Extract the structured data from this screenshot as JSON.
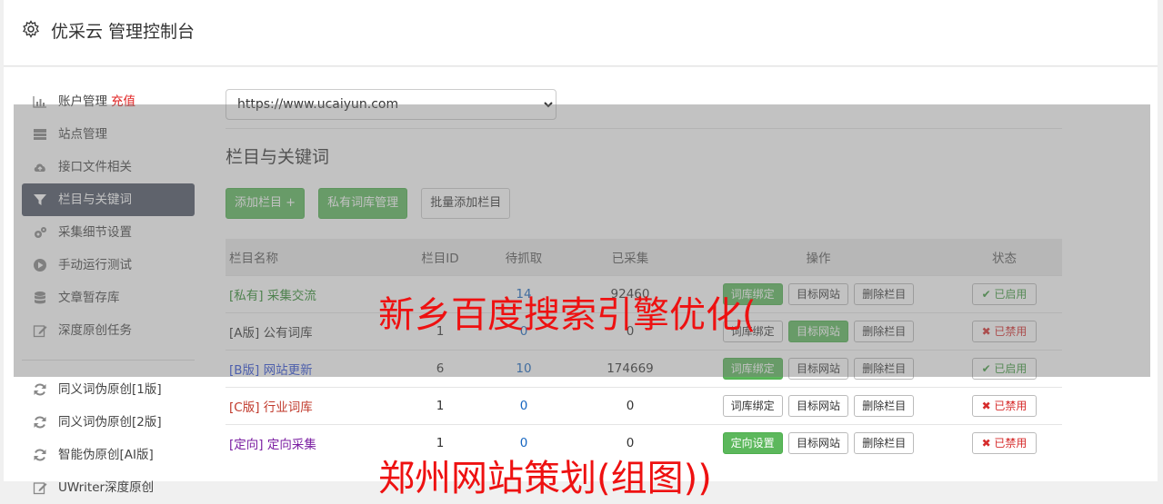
{
  "header": {
    "title": "优采云 管理控制台"
  },
  "sidebar": {
    "account_label": "账户管理",
    "recharge": "充值",
    "items": [
      {
        "label": "站点管理",
        "icon": "server-icon"
      },
      {
        "label": "接口文件相关",
        "icon": "cloud-upload-icon"
      },
      {
        "label": "栏目与关键词",
        "icon": "filter-icon"
      },
      {
        "label": "采集细节设置",
        "icon": "gears-icon"
      },
      {
        "label": "手动运行测试",
        "icon": "play-icon"
      },
      {
        "label": "文章暂存库",
        "icon": "database-icon"
      },
      {
        "label": "深度原创任务",
        "icon": "edit-icon"
      }
    ],
    "tools": [
      {
        "label": "同义词伪原创[1版]",
        "icon": "refresh-icon"
      },
      {
        "label": "同义词伪原创[2版]",
        "icon": "refresh-icon"
      },
      {
        "label": "智能伪原创[AI版]",
        "icon": "refresh-icon"
      },
      {
        "label": "UWriter深度原创",
        "icon": "edit-icon"
      }
    ]
  },
  "site_select": {
    "value": "https://www.ucaiyun.com"
  },
  "section": {
    "title": "栏目与关键词"
  },
  "buttons": {
    "add_column": "添加栏目 +",
    "private_lib": "私有词库管理",
    "batch_add": "批量添加栏目"
  },
  "table": {
    "headers": [
      "栏目名称",
      "栏目ID",
      "待抓取",
      "已采集",
      "操作",
      "状态"
    ],
    "rows": [
      {
        "tag": "[私有]",
        "name": "采集交流",
        "id": "",
        "pending": "14",
        "collected": "92460",
        "op1": "词库绑定",
        "op2": "目标网站",
        "op3": "删除栏目",
        "status": "✔ 已启用"
      },
      {
        "tag": "[A版]",
        "name": "公有词库",
        "id": "1",
        "pending": "0",
        "collected": "0",
        "op1": "词库绑定",
        "op2": "目标网站",
        "op3": "删除栏目",
        "status": "✖ 已禁用"
      },
      {
        "tag": "[B版]",
        "name": "网站更新",
        "id": "6",
        "pending": "10",
        "collected": "174669",
        "op1": "词库绑定",
        "op2": "目标网站",
        "op3": "删除栏目",
        "status": "✔ 已启用"
      },
      {
        "tag": "[C版]",
        "name": "行业词库",
        "id": "1",
        "pending": "0",
        "collected": "0",
        "op1": "词库绑定",
        "op2": "目标网站",
        "op3": "删除栏目",
        "status": "✖ 已禁用"
      },
      {
        "tag": "[定向]",
        "name": "定向采集",
        "id": "1",
        "pending": "0",
        "collected": "0",
        "op1": "定向设置",
        "op2": "目标网站",
        "op3": "删除栏目",
        "status": "✖ 已禁用"
      }
    ]
  },
  "watermarks": {
    "top": "新乡百度搜索引擎优化(",
    "bottom": "郑州网站策划(组图))"
  }
}
